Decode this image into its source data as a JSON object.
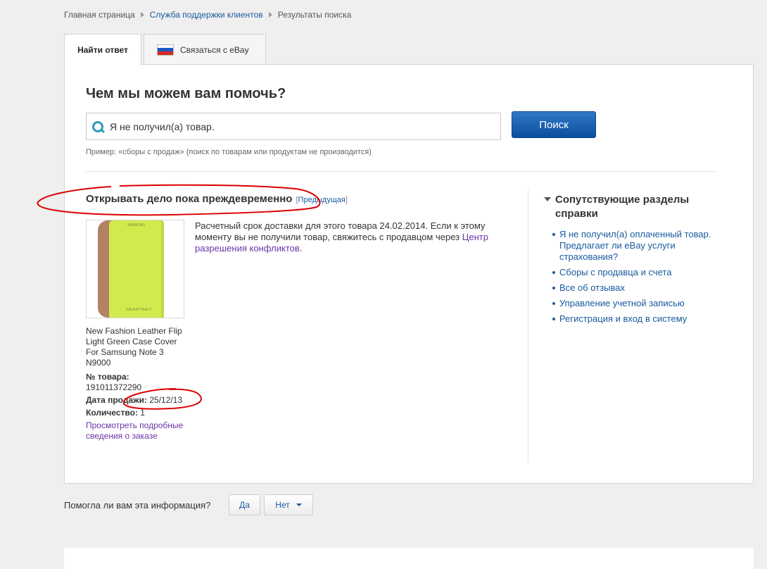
{
  "breadcrumb": {
    "home": "Главная страница",
    "support": "Служба поддержки клиентов",
    "current": "Результаты поиска"
  },
  "tabs": {
    "find_answer": "Найти ответ",
    "contact_ebay": "Связаться с eBay"
  },
  "colors": {
    "accent": "#0c4d9c",
    "link": "#1a5aa0",
    "visited_link": "#6a35a8",
    "annotation": "#dd0000"
  },
  "search": {
    "heading": "Чем мы можем вам помочь?",
    "value": "Я не получил(а) товар.",
    "button": "Поиск",
    "example": "Пример: «сборы с продаж» (поиск по товарам или продуктам не производится)"
  },
  "result": {
    "title": "Открывать дело пока преждевременно",
    "prev_open": "[",
    "prev_link": "Предыдущая",
    "prev_close": "]",
    "description": "Расчетный срок доставки для этого товара 24.02.2014. Если к этому моменту вы не получили товар, свяжитесь с продавцом через",
    "description_link": "Центр разрешения конфликтов",
    "description_end": "."
  },
  "item": {
    "title": "New Fashion Leather Flip Light Green Case Cover For Samsung Note 3 N9000",
    "image_text_top": "SAMSUNG",
    "image_text_bottom": "GALAXY Note 3",
    "number_label": "№ товара:",
    "number_value": "191011372290",
    "sale_date_label": "Дата продажи:",
    "sale_date_value": "25/12/13",
    "quantity_label": "Количество:",
    "quantity_value": "1",
    "view_order_link": "Просмотреть подробные сведения о заказе"
  },
  "related": {
    "title": "Сопутствующие разделы справки",
    "items": [
      "Я не получил(а) оплаченный товар. Предлагает ли eBay услуги страхования?",
      "Сборы с продавца и счета",
      "Все об отзывах",
      "Управление учетной записью",
      "Регистрация и вход в систему"
    ]
  },
  "feedback": {
    "question": "Помогла ли вам эта информация?",
    "yes": "Да",
    "no": "Нет"
  }
}
